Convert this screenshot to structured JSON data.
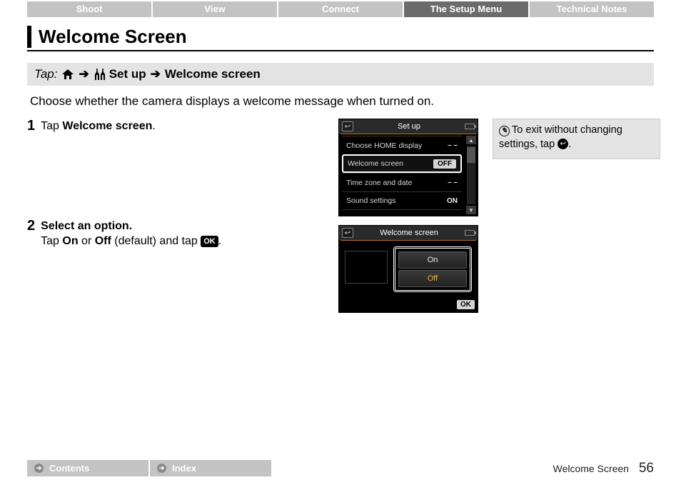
{
  "tabs": [
    "Shoot",
    "View",
    "Connect",
    "The Setup Menu",
    "Technical Notes"
  ],
  "active_tab_index": 3,
  "heading": "Welcome Screen",
  "breadcrumb": {
    "tap_label": "Tap:",
    "setup_label": "Set up",
    "dest_label": "Welcome screen"
  },
  "description": "Choose whether the camera displays a welcome message when turned on.",
  "steps": [
    {
      "num": "1",
      "title_prefix": "Tap ",
      "title_bold": "Welcome screen",
      "title_suffix": "."
    },
    {
      "num": "2",
      "title_bold": "Select an option.",
      "body_prefix": "Tap ",
      "body_b1": "On",
      "body_mid": " or ",
      "body_b2": "Off",
      "body_after": " (default) and tap ",
      "ok": "OK",
      "body_end": "."
    }
  ],
  "screen1": {
    "title": "Set up",
    "rows": [
      {
        "label": "Choose HOME display",
        "value": "– –"
      },
      {
        "label": "Welcome screen",
        "value": "OFF",
        "selected": true
      },
      {
        "label": "Time zone and date",
        "value": "– –"
      },
      {
        "label": "Sound settings",
        "value": "ON"
      }
    ]
  },
  "screen2": {
    "title": "Welcome screen",
    "options": [
      "On",
      "Off"
    ],
    "selected_index": 1,
    "ok": "OK"
  },
  "tip": {
    "text_a": "To exit without changing settings, tap ",
    "text_b": "."
  },
  "footer": {
    "links": [
      "Contents",
      "Index"
    ],
    "section": "Welcome Screen",
    "page": "56"
  }
}
